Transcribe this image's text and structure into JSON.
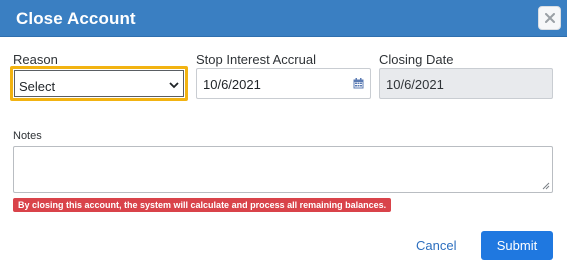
{
  "dialog": {
    "title": "Close Account",
    "close_icon": "close-icon"
  },
  "form": {
    "reason": {
      "label": "Reason",
      "value": "Select"
    },
    "stop_interest_accrual": {
      "label": "Stop Interest Accrual",
      "value": "10/6/2021",
      "icon": "calendar-icon"
    },
    "closing_date": {
      "label": "Closing Date",
      "value": "10/6/2021"
    },
    "notes": {
      "label": "Notes",
      "value": ""
    }
  },
  "warning": "By closing this account, the system will calculate and process all remaining balances.",
  "footer": {
    "cancel_label": "Cancel",
    "submit_label": "Submit"
  },
  "colors": {
    "header": "#3a7fc2",
    "focus_outline": "#f2b312",
    "warning_bg": "#d9434a",
    "submit_bg": "#1f78e0",
    "link": "#2d6fbf"
  }
}
